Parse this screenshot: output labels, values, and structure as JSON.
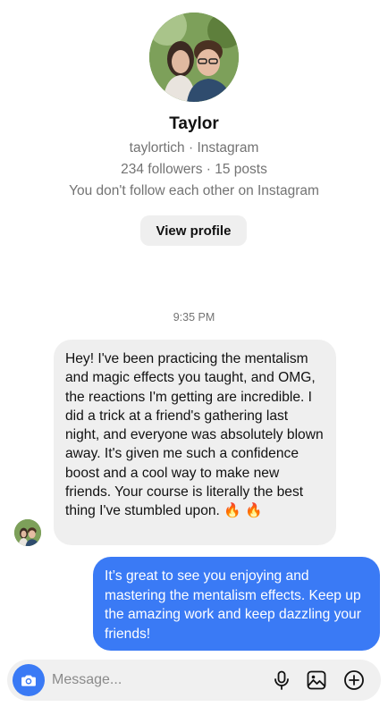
{
  "profile": {
    "name": "Taylor",
    "handle_line": "taylortich · Instagram",
    "stats_line": "234 followers · 15 posts",
    "follow_status": "You don't follow each other on Instagram",
    "view_profile_label": "View profile"
  },
  "conversation": {
    "timestamp": "9:35 PM",
    "messages": [
      {
        "direction": "incoming",
        "text": "Hey! I've been practicing the mentalism and magic effects you taught, and OMG, the reactions I'm getting are incredible. I did a trick at a friend's gathering last night, and everyone was absolutely blown away. It's given me such a confidence boost and a cool way to make new friends. Your course is literally the best thing I've stumbled upon. 🔥 🔥"
      },
      {
        "direction": "outgoing",
        "text": "It’s great to see you enjoying and mastering the mentalism effects. Keep up the amazing work and keep dazzling your friends!"
      }
    ]
  },
  "composer": {
    "placeholder": "Message...",
    "icons": [
      "camera-icon",
      "microphone-icon",
      "gallery-icon",
      "plus-icon"
    ]
  },
  "colors": {
    "accent": "#3a7af5",
    "incoming_bubble": "#efefef",
    "muted_text": "#737373"
  }
}
